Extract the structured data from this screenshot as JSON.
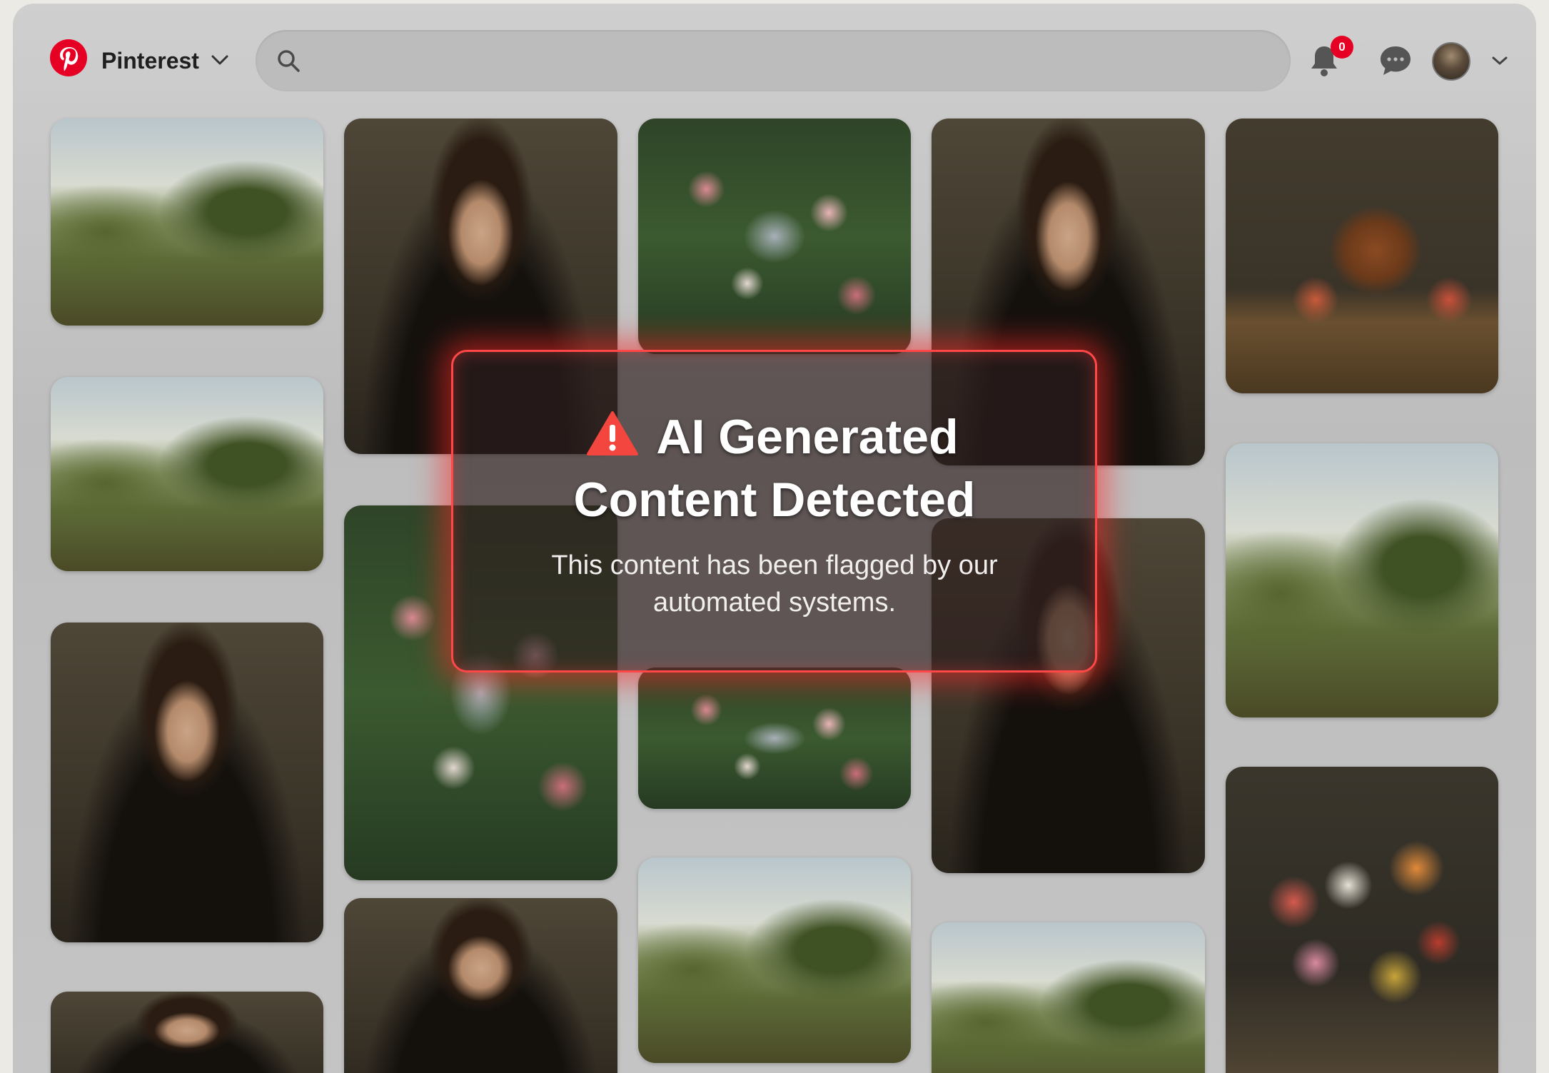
{
  "header": {
    "brand": "Pinterest",
    "search_placeholder": "",
    "notification_count": "0"
  },
  "alert": {
    "title_line1": "AI Generated",
    "title_line2": "Content Detected",
    "message_line1": "This content has been flagged by our",
    "message_line2": "automated systems."
  },
  "colors": {
    "brand_red": "#e60023",
    "alert_red": "#ff4747"
  },
  "icons": [
    "pinterest-logo-icon",
    "chevron-down-icon",
    "search-icon",
    "bell-icon",
    "chat-icon",
    "avatar",
    "warning-icon"
  ]
}
